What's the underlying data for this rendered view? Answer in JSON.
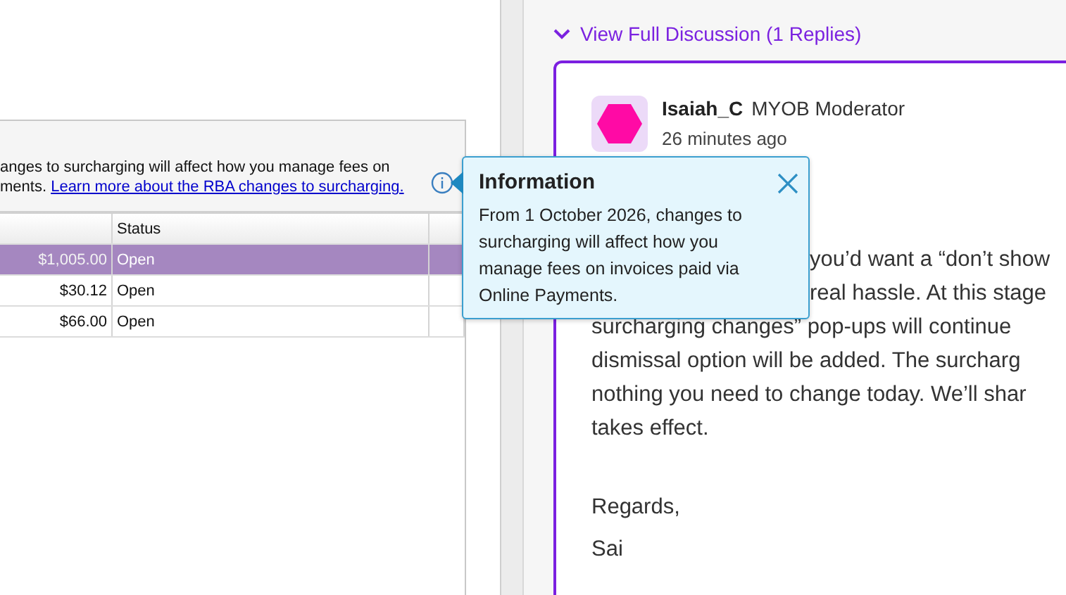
{
  "invoice_window": {
    "notice": {
      "text": "anges to surcharging will affect how you manage fees on",
      "text_2": "ments.",
      "link": "Learn more about the RBA changes to surcharging."
    },
    "table": {
      "columns": [
        "Status"
      ],
      "rows": [
        {
          "amount": "$1,005.00",
          "status": "Open",
          "selected": true
        },
        {
          "amount": "$30.12",
          "status": "Open",
          "selected": false
        },
        {
          "amount": "$66.00",
          "status": "Open",
          "selected": false
        }
      ]
    }
  },
  "popup": {
    "title": "Information",
    "body": "From 1 October 2026, changes to surcharging will affect how you manage fees on invoices paid via Online Payments."
  },
  "discussion": {
    "toggle": "View Full Discussion (1 Replies)",
    "expanded": true,
    "reply": {
      "author": "Isaiah_C",
      "role": "MYOB Moderator",
      "time": "26 minutes ago",
      "lines_beside_popup": [
        "you’d want a “don’t show",
        "real hassle. At this stage"
      ],
      "lines": [
        "surcharging changes” pop-ups will continue",
        "dismissal option will be added. The surcharg",
        "nothing you need to change today. We’ll shar",
        "takes effect."
      ],
      "signoff": [
        "Regards,",
        "Sai"
      ]
    }
  }
}
